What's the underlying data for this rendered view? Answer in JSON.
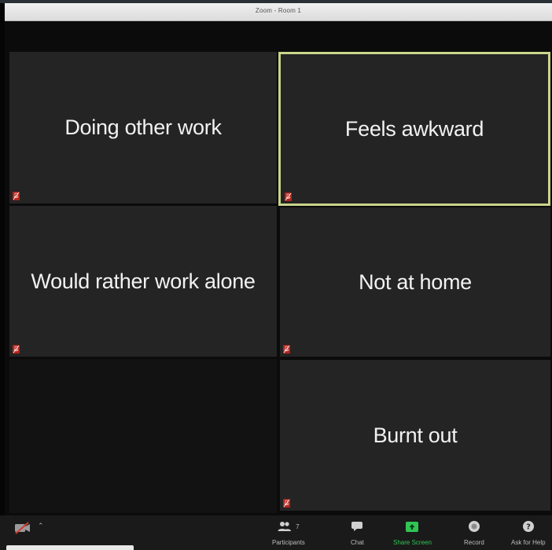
{
  "window": {
    "title": "Zoom - Room 1"
  },
  "participants": [
    {
      "name": "Doing other work",
      "muted": true,
      "active_speaker": false
    },
    {
      "name": "Feels awkward",
      "muted": true,
      "active_speaker": true
    },
    {
      "name": "Would rather work alone",
      "muted": true,
      "active_speaker": false
    },
    {
      "name": "Not at home",
      "muted": true,
      "active_speaker": false
    },
    {
      "name": "Burnt out",
      "muted": true,
      "active_speaker": false
    }
  ],
  "toolbar": {
    "video_icon": "video-off-icon",
    "participants_label": "Participants",
    "participants_count": "7",
    "chat_label": "Chat",
    "share_label": "Share Screen",
    "record_label": "Record",
    "help_label": "Ask for Help"
  },
  "colors": {
    "active_border": "#c9d48a",
    "tile_bg": "#242424",
    "share_green": "#2fc653",
    "mute_red": "#b3241c"
  }
}
